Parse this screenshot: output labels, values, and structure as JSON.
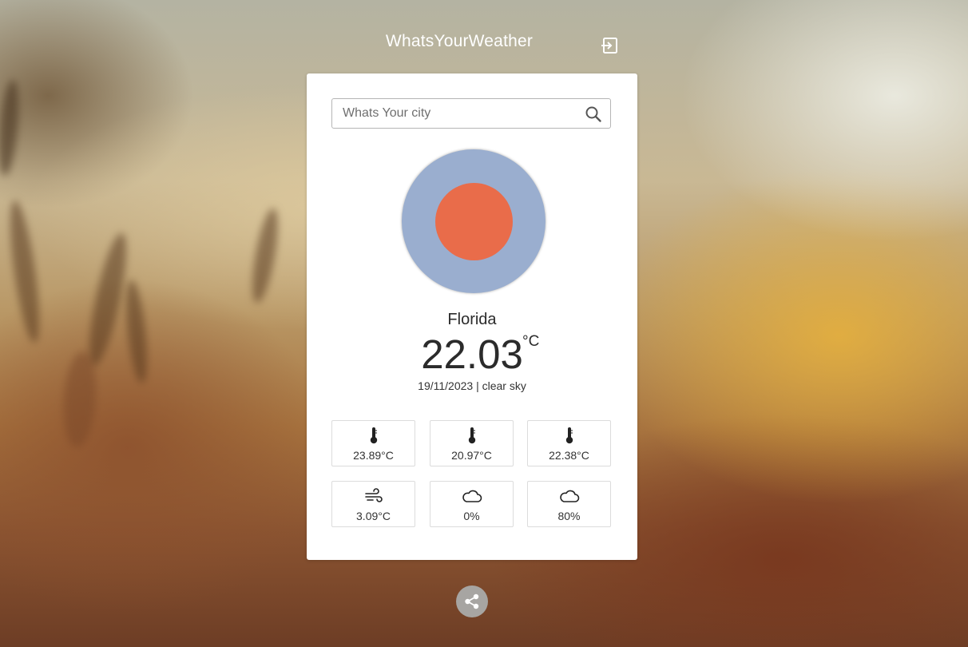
{
  "app": {
    "title": "WhatsYourWeather"
  },
  "search": {
    "placeholder": "Whats Your city",
    "value": ""
  },
  "weather": {
    "city": "Florida",
    "temperature": "22.03",
    "unit": "°C",
    "date": "19/11/2023",
    "separator": "|",
    "description": "clear sky"
  },
  "details": [
    {
      "icon": "thermometer-icon",
      "value": "23.89°C"
    },
    {
      "icon": "thermometer-icon",
      "value": "20.97°C"
    },
    {
      "icon": "thermometer-icon",
      "value": "22.38°C"
    },
    {
      "icon": "wind-icon",
      "value": "3.09°C"
    },
    {
      "icon": "cloud-icon",
      "value": "0%"
    },
    {
      "icon": "cloud-icon",
      "value": "80%"
    }
  ],
  "icons": {
    "logout": "logout-icon",
    "search": "search-icon",
    "weather": "clear-sky-icon",
    "share": "share-icon"
  },
  "colors": {
    "weather_icon_ring": "#9aaecf",
    "weather_icon_sun": "#e96c4a",
    "card_background": "#ffffff",
    "share_button": "#a7a5a2"
  }
}
